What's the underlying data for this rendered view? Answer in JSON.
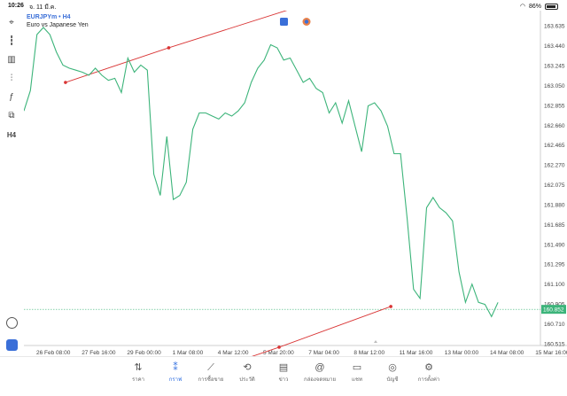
{
  "status": {
    "time": "10:26",
    "date": "จ. 11 มี.ค.",
    "battery": "86%"
  },
  "chart_header": {
    "symbol": "EURJPYm • H4",
    "description": "Euro vs Japanese Yen"
  },
  "toolbar": [
    {
      "name": "crosshair-icon",
      "glyph": "⌖"
    },
    {
      "name": "candles-icon",
      "glyph": "┇"
    },
    {
      "name": "volume-icon",
      "glyph": "▥"
    },
    {
      "name": "indicators-icon",
      "glyph": "⫶"
    },
    {
      "name": "function-icon",
      "glyph": "ƒ"
    },
    {
      "name": "objects-icon",
      "glyph": "⧉"
    },
    {
      "name": "timeframe-label",
      "glyph": "H4"
    }
  ],
  "chart_data": {
    "type": "line",
    "series": [
      {
        "values": [
          162.8,
          163.0,
          163.55,
          163.62,
          163.55,
          163.38,
          163.25,
          163.22,
          163.2,
          163.18,
          163.15,
          163.22,
          163.15,
          163.1,
          163.12,
          162.98,
          163.32,
          163.18,
          163.25,
          163.2,
          162.18,
          161.97,
          162.55,
          161.93,
          161.97,
          162.1,
          162.62,
          162.78,
          162.78,
          162.75,
          162.72,
          162.78,
          162.75,
          162.8,
          162.88,
          163.08,
          163.22,
          163.3,
          163.45,
          163.42,
          163.3,
          163.32,
          163.2,
          163.08,
          163.12,
          163.02,
          162.98,
          162.78,
          162.88,
          162.68,
          162.9,
          162.65,
          162.4,
          162.85,
          162.88,
          162.8,
          162.65,
          162.38,
          162.38,
          161.75,
          161.05,
          160.96,
          161.85,
          161.95,
          161.85,
          161.8,
          161.72,
          161.22,
          160.92,
          161.1,
          160.92,
          160.9,
          160.78,
          160.92
        ],
        "color": "#3cb47a"
      }
    ],
    "x_tick_labels": [
      "26 Feb 08:00",
      "27 Feb 16:00",
      "29 Feb 00:00",
      "1 Mar 08:00",
      "4 Mar 12:00",
      "5 Mar 20:00",
      "7 Mar 04:00",
      "8 Mar 12:00",
      "11 Mar 16:00",
      "13 Mar 00:00",
      "14 Mar 08:00",
      "15 Mar 16:00"
    ],
    "y_tick_labels": [
      "163.635",
      "163.440",
      "163.245",
      "163.050",
      "162.855",
      "162.660",
      "162.465",
      "162.270",
      "162.075",
      "161.880",
      "161.685",
      "161.490",
      "161.295",
      "161.100",
      "160.905",
      "160.710",
      "160.515"
    ],
    "y_ticks": [
      163.635,
      163.44,
      163.245,
      163.05,
      162.855,
      162.66,
      162.465,
      162.27,
      162.075,
      161.88,
      161.685,
      161.49,
      161.295,
      161.1,
      160.905,
      160.71,
      160.515
    ],
    "ylim": [
      160.375,
      163.785
    ],
    "current_price": {
      "value": 160.852,
      "label": "160.852"
    },
    "trendlines": [
      {
        "points": [
          [
            6.4,
            163.08
          ],
          [
            22.3,
            163.42
          ],
          [
            48.5,
            163.95
          ]
        ],
        "color": "#d93535",
        "markers": [
          0,
          1
        ]
      },
      {
        "points": [
          [
            25.0,
            160.17
          ],
          [
            39.3,
            160.48
          ],
          [
            56.5,
            160.88
          ]
        ],
        "color": "#d93535",
        "markers": [
          1,
          2
        ]
      }
    ],
    "grid": false
  },
  "bottom_nav": [
    {
      "name": "nav-quotes",
      "glyph": "⇅",
      "label": "ราคา"
    },
    {
      "name": "nav-chart",
      "glyph": "⁑",
      "label": "กราฟ",
      "active": true
    },
    {
      "name": "nav-trade",
      "glyph": "⟋",
      "label": "การซื้อขาย"
    },
    {
      "name": "nav-history",
      "glyph": "⟲",
      "label": "ประวัติ"
    },
    {
      "name": "nav-news",
      "glyph": "▤",
      "label": "ข่าว"
    },
    {
      "name": "nav-mailbox",
      "glyph": "@",
      "label": "กล่องจดหมาย"
    },
    {
      "name": "nav-chat",
      "glyph": "▭",
      "label": "แชท"
    },
    {
      "name": "nav-accounts",
      "glyph": "◎",
      "label": "บัญชี"
    },
    {
      "name": "nav-settings",
      "glyph": "⚙",
      "label": "การตั้งค่า"
    }
  ]
}
